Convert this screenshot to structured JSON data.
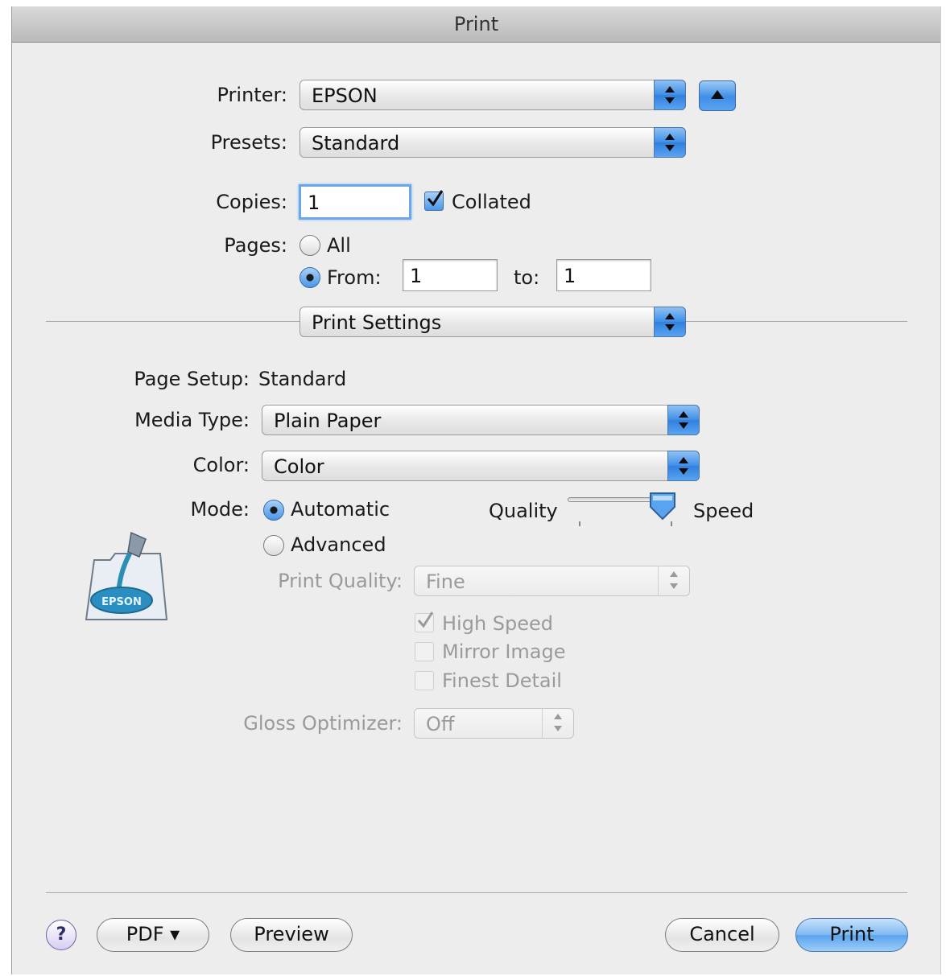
{
  "window": {
    "title": "Print"
  },
  "printer": {
    "label": "Printer:",
    "value": "EPSON"
  },
  "presets": {
    "label": "Presets:",
    "value": "Standard"
  },
  "copies": {
    "label": "Copies:",
    "value": "1",
    "collated_label": "Collated",
    "collated_checked": true
  },
  "pages": {
    "label": "Pages:",
    "all_label": "All",
    "from_label": "From:",
    "from_value": "1",
    "to_label": "to:",
    "to_value": "1",
    "selected": "from"
  },
  "panel_select": {
    "value": "Print Settings"
  },
  "settings": {
    "page_setup_label": "Page Setup:",
    "page_setup_value": "Standard",
    "media_type_label": "Media Type:",
    "media_type_value": "Plain Paper",
    "color_label": "Color:",
    "color_value": "Color",
    "mode_label": "Mode:",
    "mode_automatic": "Automatic",
    "mode_advanced": "Advanced",
    "mode_selected": "automatic",
    "slider_left": "Quality",
    "slider_right": "Speed",
    "slider_position": 1.0,
    "print_quality_label": "Print Quality:",
    "print_quality_value": "Fine",
    "high_speed_label": "High Speed",
    "high_speed_checked": true,
    "mirror_image_label": "Mirror Image",
    "mirror_image_checked": false,
    "finest_detail_label": "Finest Detail",
    "finest_detail_checked": false,
    "gloss_optimizer_label": "Gloss Optimizer:",
    "gloss_optimizer_value": "Off",
    "logo_text": "EPSON"
  },
  "footer": {
    "help_label": "?",
    "pdf_label": "PDF ▾",
    "preview_label": "Preview",
    "cancel_label": "Cancel",
    "print_label": "Print"
  },
  "colors": {
    "accent_blue": "#3f8ee8",
    "window_bg": "#ededed",
    "disabled_text": "#9a9a9a"
  }
}
